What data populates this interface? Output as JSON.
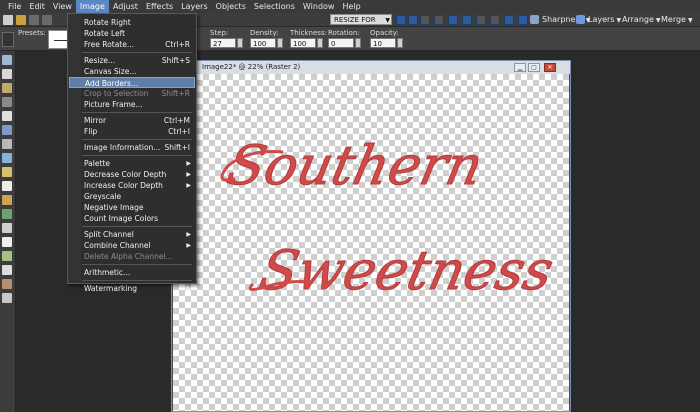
{
  "menubar": {
    "items": [
      "File",
      "Edit",
      "View",
      "Image",
      "Adjust",
      "Effects",
      "Layers",
      "Objects",
      "Selections",
      "Window",
      "Help"
    ],
    "active": "Image"
  },
  "toolbar": {
    "resize_label": "RESIZE FOR WEB",
    "sharpness_label": "Sharpness",
    "layers_label": "Layers",
    "arrange_label": "Arrange",
    "merge_label": "Merge"
  },
  "options": {
    "presets_label": "Presets:",
    "step_label": "Step:",
    "step_value": "27",
    "density_label": "Density:",
    "density_value": "100",
    "thickness_label": "Thickness:",
    "thickness_value": "100",
    "rotation_label": "Rotation:",
    "rotation_value": "0",
    "opacity_label": "Opacity:",
    "opacity_value": "10"
  },
  "image_menu": {
    "items": [
      {
        "label": "Rotate Right",
        "shortcut": "",
        "disabled": false,
        "submenu": false
      },
      {
        "label": "Rotate Left",
        "shortcut": "",
        "disabled": false,
        "submenu": false
      },
      {
        "label": "Free Rotate...",
        "shortcut": "Ctrl+R",
        "disabled": false,
        "submenu": false
      },
      {
        "label": "Resize...",
        "shortcut": "Shift+S",
        "disabled": false,
        "submenu": false
      },
      {
        "label": "Canvas Size...",
        "shortcut": "",
        "disabled": false,
        "submenu": false
      },
      {
        "label": "Add Borders...",
        "shortcut": "",
        "disabled": false,
        "submenu": false
      },
      {
        "label": "Crop to Selection",
        "shortcut": "Shift+R",
        "disabled": true,
        "submenu": false
      },
      {
        "label": "Picture Frame...",
        "shortcut": "",
        "disabled": false,
        "submenu": false
      },
      {
        "label": "Mirror",
        "shortcut": "Ctrl+M",
        "disabled": false,
        "submenu": false
      },
      {
        "label": "Flip",
        "shortcut": "Ctrl+I",
        "disabled": false,
        "submenu": false
      },
      {
        "label": "Image Information...",
        "shortcut": "Shift+I",
        "disabled": false,
        "submenu": false
      },
      {
        "label": "Palette",
        "shortcut": "",
        "disabled": false,
        "submenu": true
      },
      {
        "label": "Decrease Color Depth",
        "shortcut": "",
        "disabled": false,
        "submenu": true
      },
      {
        "label": "Increase Color Depth",
        "shortcut": "",
        "disabled": false,
        "submenu": true
      },
      {
        "label": "Greyscale",
        "shortcut": "",
        "disabled": false,
        "submenu": false
      },
      {
        "label": "Negative Image",
        "shortcut": "",
        "disabled": false,
        "submenu": false
      },
      {
        "label": "Count Image Colors",
        "shortcut": "",
        "disabled": false,
        "submenu": false
      },
      {
        "label": "Split Channel",
        "shortcut": "",
        "disabled": false,
        "submenu": true
      },
      {
        "label": "Combine Channel",
        "shortcut": "",
        "disabled": false,
        "submenu": true
      },
      {
        "label": "Delete Alpha Channel...",
        "shortcut": "",
        "disabled": true,
        "submenu": false
      },
      {
        "label": "Arithmetic...",
        "shortcut": "",
        "disabled": false,
        "submenu": false
      },
      {
        "label": "Watermarking",
        "shortcut": "",
        "disabled": false,
        "submenu": true
      }
    ],
    "highlighted": "Add Borders..."
  },
  "document": {
    "title": "Image22* @ 22% (Raster 2)",
    "artwork_line1": "Southern",
    "artwork_line2": "Sweetness",
    "text_color": "#d04a4a"
  },
  "colors": {
    "accent": "#5b87c4",
    "background": "#2b2b2b"
  }
}
